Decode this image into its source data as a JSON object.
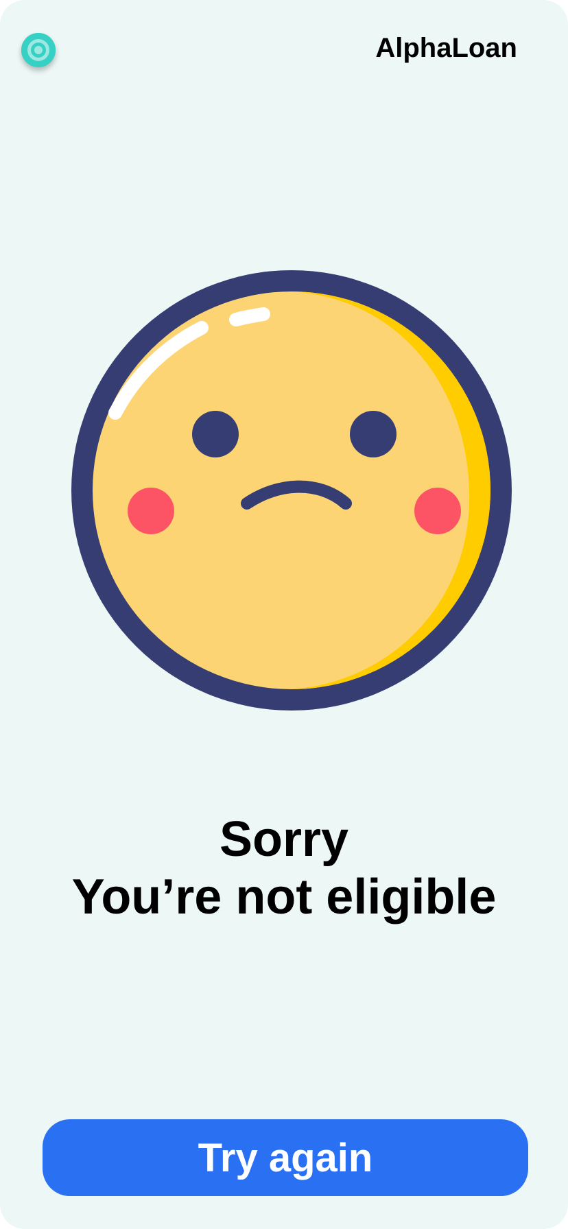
{
  "app": {
    "brand_name": "AlphaLoan"
  },
  "status": {
    "heading": "Sorry",
    "subheading": "You’re not eligible",
    "illustration_icon": "sad-face-icon",
    "logo_icon": "target-logo-icon"
  },
  "actions": {
    "retry_label": "Try again"
  },
  "colors": {
    "background": "#ecf7f6",
    "accent_button": "#2970f3",
    "emoji_face": "#fdd473",
    "emoji_outline": "#353d73",
    "emoji_shadow": "#ffcc00",
    "emoji_cheek": "#fc5465",
    "logo": "#36d1c4"
  }
}
